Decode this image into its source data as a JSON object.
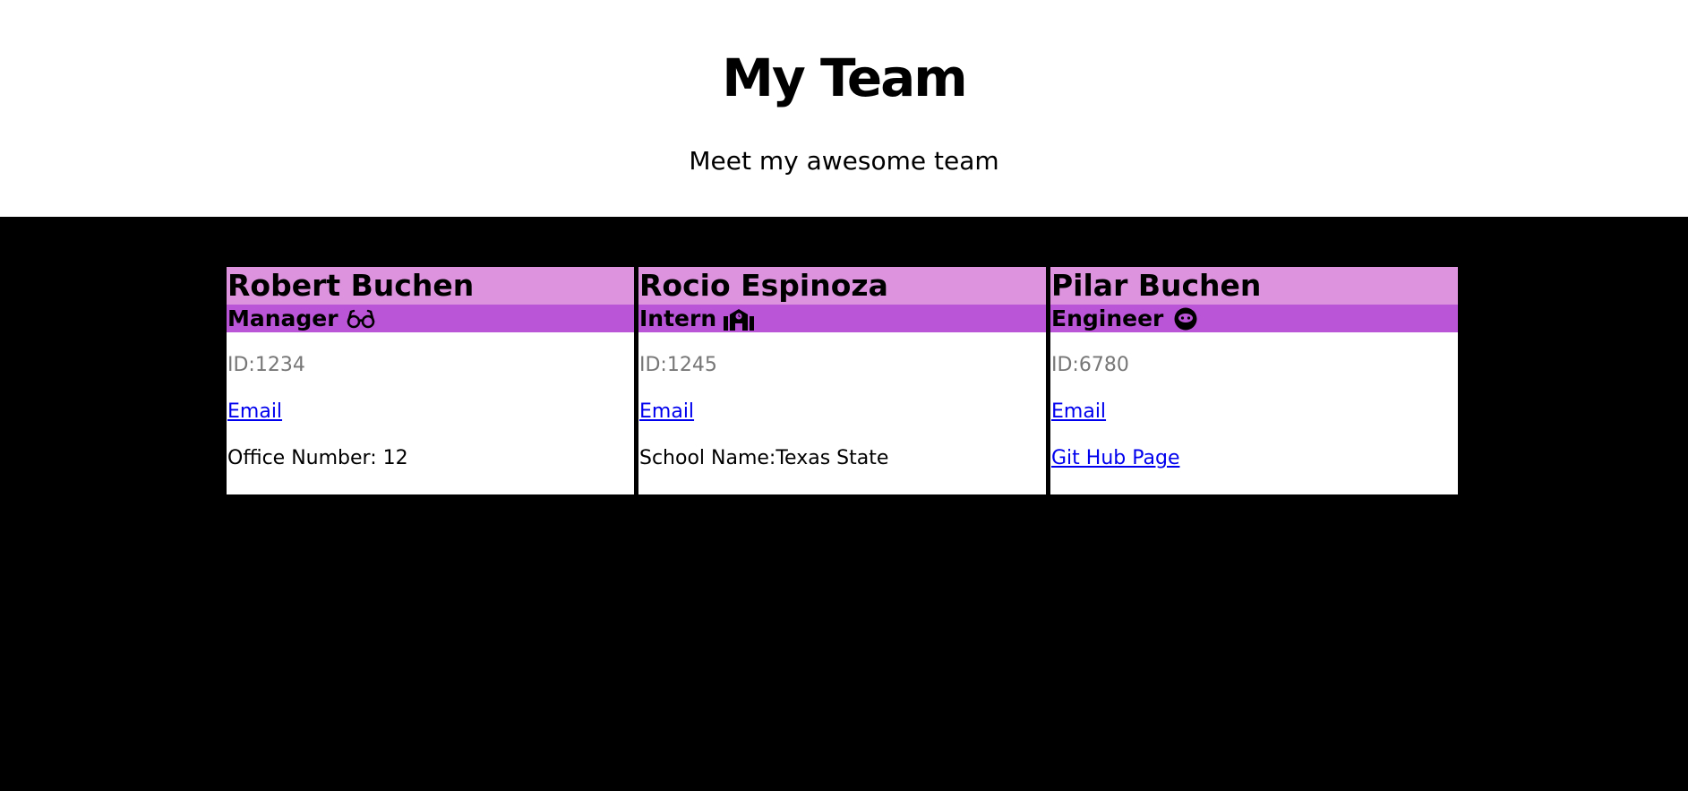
{
  "header": {
    "title": "My Team",
    "subtitle": "Meet my awesome team"
  },
  "colors": {
    "name_bar": "#dd93de",
    "role_bar": "#bb55d8",
    "link": "#0000ee",
    "id_text": "#777777"
  },
  "team": [
    {
      "name": "Robert Buchen",
      "role": "Manager",
      "role_icon": "glasses-icon",
      "id_label": "ID:1234",
      "email_label": "Email",
      "extra_label": "Office Number: 12"
    },
    {
      "name": "Rocio Espinoza",
      "role": "Intern",
      "role_icon": "school-icon",
      "id_label": "ID:1245",
      "email_label": "Email",
      "extra_label": "School Name:Texas State"
    },
    {
      "name": "Pilar Buchen",
      "role": "Engineer",
      "role_icon": "github-octocat-icon",
      "id_label": "ID:6780",
      "email_label": "Email",
      "extra_label": "Git Hub Page"
    }
  ]
}
